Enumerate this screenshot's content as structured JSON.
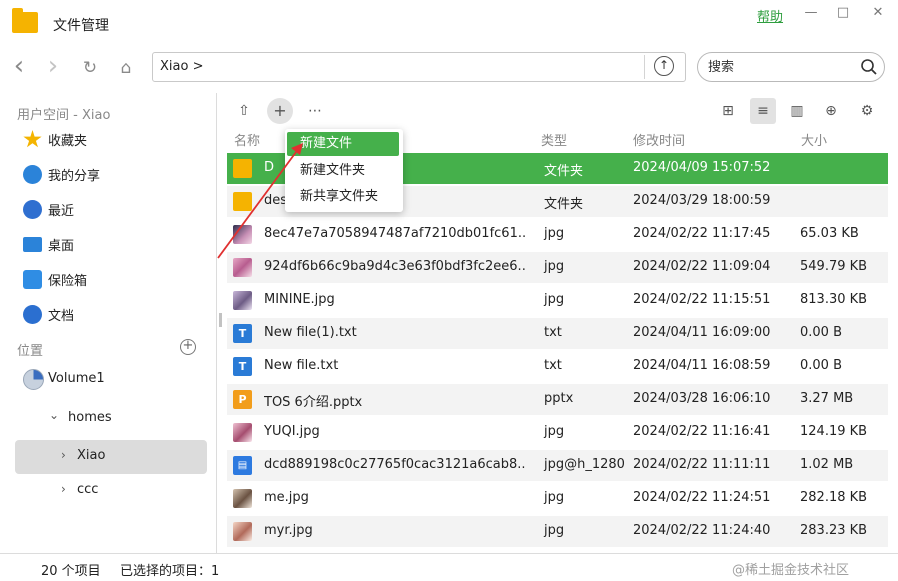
{
  "window": {
    "title": "文件管理",
    "help_label": "帮助",
    "minimize": "—",
    "maximize": "□",
    "close": "✕"
  },
  "nav": {
    "back_icon": "‹",
    "forward_icon": "›",
    "refresh_icon": "↻",
    "home_icon": "⌂",
    "address": "Xiao >",
    "go_icon": "↑",
    "search_placeholder": "搜索"
  },
  "sidebar": {
    "user_section": "用户空间 - Xiao",
    "items": [
      {
        "label": "收藏夹",
        "icon": "star-icon",
        "color": "#f4b400"
      },
      {
        "label": "我的分享",
        "icon": "share-icon",
        "color": "#2b83d9"
      },
      {
        "label": "最近",
        "icon": "clock-icon",
        "color": "#2f6fd0"
      },
      {
        "label": "桌面",
        "icon": "desktop-icon",
        "color": "#2b83d9"
      },
      {
        "label": "保险箱",
        "icon": "safe-icon",
        "color": "#2f8de4"
      },
      {
        "label": "文档",
        "icon": "document-icon",
        "color": "#2b6fd0"
      }
    ],
    "location_section": "位置",
    "add_location_icon": "+",
    "tree": {
      "volume": "Volume1",
      "homes": "homes",
      "xiao": "Xiao",
      "ccc": "ccc",
      "expand_icon": "⌄",
      "collapse_icon": "›"
    }
  },
  "toolbar": {
    "upload_icon": "⇧",
    "new_icon": "+",
    "more_icon": "⋯",
    "view_icons": [
      "⊞",
      "≡",
      "▥",
      "⊕",
      "⚙"
    ]
  },
  "columns": {
    "name": "名称",
    "type": "类型",
    "modified": "修改时间",
    "size": "大小"
  },
  "context_menu": {
    "items": [
      "新建文件",
      "新建文件夹",
      "新共享文件夹"
    ]
  },
  "files": [
    {
      "name": "D",
      "type": "文件夹",
      "modified": "2024/04/09 15:07:52",
      "size": "",
      "icon": "folder"
    },
    {
      "name": "des",
      "type": "文件夹",
      "modified": "2024/03/29 18:00:59",
      "size": "",
      "icon": "folder"
    },
    {
      "name": "8ec47e7a7058947487af7210db01fc61...",
      "type": "jpg",
      "modified": "2024/02/22 11:17:45",
      "size": "65.03 KB",
      "icon": "image-a"
    },
    {
      "name": "924df6b66c9ba9d4c3e63f0bdf3fc2ee6...",
      "type": "jpg",
      "modified": "2024/02/22 11:09:04",
      "size": "549.79 KB",
      "icon": "image-b"
    },
    {
      "name": "MININE.jpg",
      "type": "jpg",
      "modified": "2024/02/22 11:15:51",
      "size": "813.30 KB",
      "icon": "image-c"
    },
    {
      "name": "New file(1).txt",
      "type": "txt",
      "modified": "2024/04/11 16:09:00",
      "size": "0.00 B",
      "icon": "txt"
    },
    {
      "name": "New file.txt",
      "type": "txt",
      "modified": "2024/04/11 16:08:59",
      "size": "0.00 B",
      "icon": "txt"
    },
    {
      "name": "TOS 6介绍.pptx",
      "type": "pptx",
      "modified": "2024/03/28 16:06:10",
      "size": "3.27 MB",
      "icon": "ppt"
    },
    {
      "name": "YUQI.jpg",
      "type": "jpg",
      "modified": "2024/02/22 11:16:41",
      "size": "124.19 KB",
      "icon": "image-d"
    },
    {
      "name": "dcd889198c0c27765f0cac3121a6cab8...",
      "type": "jpg@h_1280",
      "modified": "2024/02/22 11:11:11",
      "size": "1.02 MB",
      "icon": "image-e"
    },
    {
      "name": "me.jpg",
      "type": "jpg",
      "modified": "2024/02/22 11:24:51",
      "size": "282.18 KB",
      "icon": "image-f"
    },
    {
      "name": "myr.jpg",
      "type": "jpg",
      "modified": "2024/02/22 11:24:40",
      "size": "283.23 KB",
      "icon": "image-g"
    }
  ],
  "icon_glyphs": {
    "txt": "T",
    "ppt": "P",
    "image-e": "▤"
  },
  "status": {
    "count": "20 个项目",
    "selected": "已选择的项目：1",
    "watermark": "@稀土掘金技术社区"
  },
  "colors": {
    "accent": "#45b04b",
    "help": "#2e9e3e",
    "folder": "#f5b301"
  }
}
